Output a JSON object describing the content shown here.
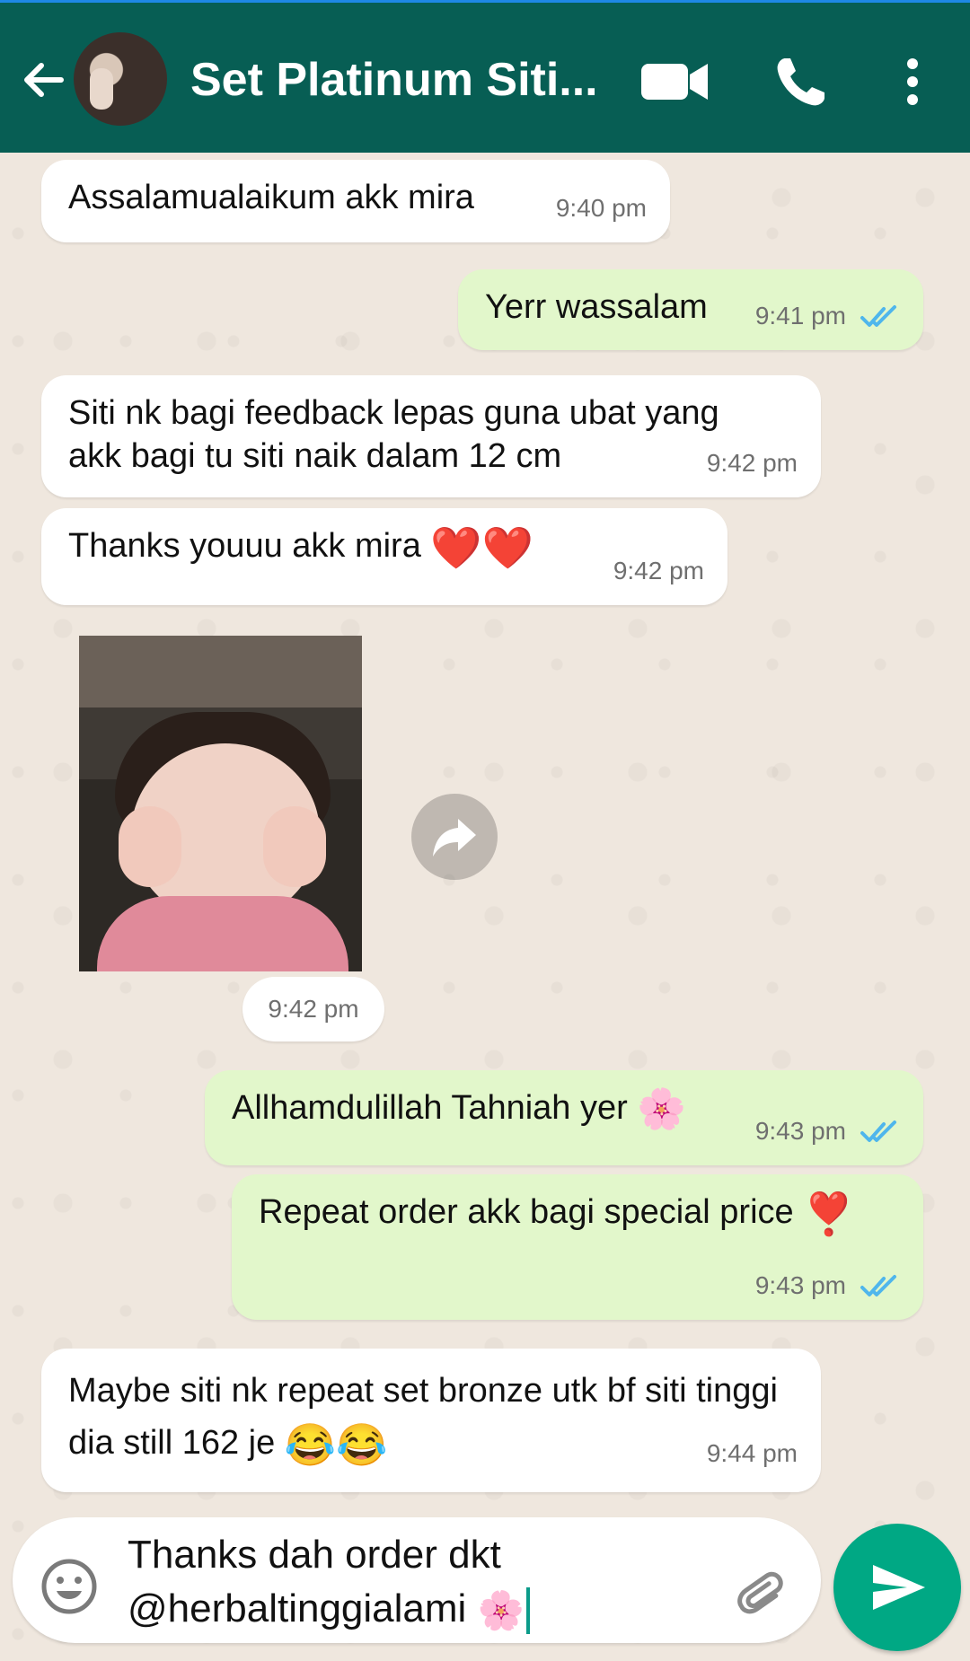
{
  "header": {
    "title": "Set Platinum Siti..."
  },
  "messages": [
    {
      "text": "Assalamualaikum akk mira",
      "time": "9:40 pm",
      "direction": "incoming"
    },
    {
      "text": "Yerr wassalam",
      "time": "9:41 pm",
      "direction": "outgoing",
      "status": "read"
    },
    {
      "text": "Siti nk bagi feedback lepas guna ubat yang akk bagi tu siti naik dalam 12 cm",
      "time": "9:42 pm",
      "direction": "incoming"
    },
    {
      "text": "Thanks youuu akk mira",
      "emoji": "❤️❤️",
      "time": "9:42 pm",
      "direction": "incoming"
    },
    {
      "type": "image",
      "time": "9:42 pm",
      "direction": "incoming"
    },
    {
      "text": "Allhamdulillah Tahniah yer",
      "emoji": "🌸",
      "time": "9:43 pm",
      "direction": "outgoing",
      "status": "read"
    },
    {
      "text": "Repeat order akk bagi special price",
      "emoji": "❣️",
      "time": "9:43 pm",
      "direction": "outgoing",
      "status": "read"
    },
    {
      "text": "Maybe siti nk repeat set bronze utk bf siti tinggi dia still 162 je",
      "emoji": "😂😂",
      "time": "9:44 pm",
      "direction": "incoming"
    }
  ],
  "composer": {
    "line1": "Thanks dah order dkt",
    "line2": "@herbaltinggialami",
    "emoji": "🌸"
  },
  "colors": {
    "header": "#075e54",
    "outgoing_bubble": "#e2f7cb",
    "incoming_bubble": "#ffffff",
    "read_ticks": "#4fb6ec",
    "send_button": "#00a884"
  },
  "icons": {
    "back": "arrow-left-icon",
    "video": "video-call-icon",
    "call": "phone-icon",
    "menu": "more-vert-icon",
    "forward": "forward-icon",
    "emoji": "smiley-icon",
    "attach": "paperclip-icon",
    "send": "send-icon"
  }
}
